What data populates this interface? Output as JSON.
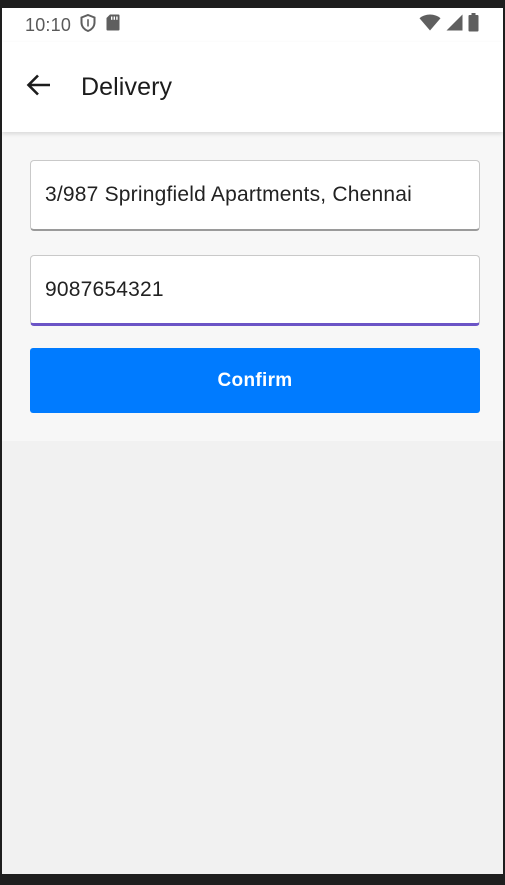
{
  "status_bar": {
    "time": "10:10",
    "left_icons": [
      "shield-icon",
      "sd-card-icon"
    ],
    "right_icons": [
      "wifi-icon",
      "cell-signal-icon",
      "battery-icon"
    ]
  },
  "app_bar": {
    "back_icon": "arrow-back-icon",
    "title": "Delivery"
  },
  "form": {
    "address": {
      "value": "3/987 Springfield Apartments, Chennai",
      "placeholder": ""
    },
    "phone": {
      "value": "9087654321",
      "placeholder": ""
    },
    "confirm_label": "Confirm"
  },
  "colors": {
    "primary_button": "#007bff",
    "focused_underline": "#6b54c6",
    "app_bar_background": "#ffffff",
    "page_background": "#f1f1f1"
  }
}
